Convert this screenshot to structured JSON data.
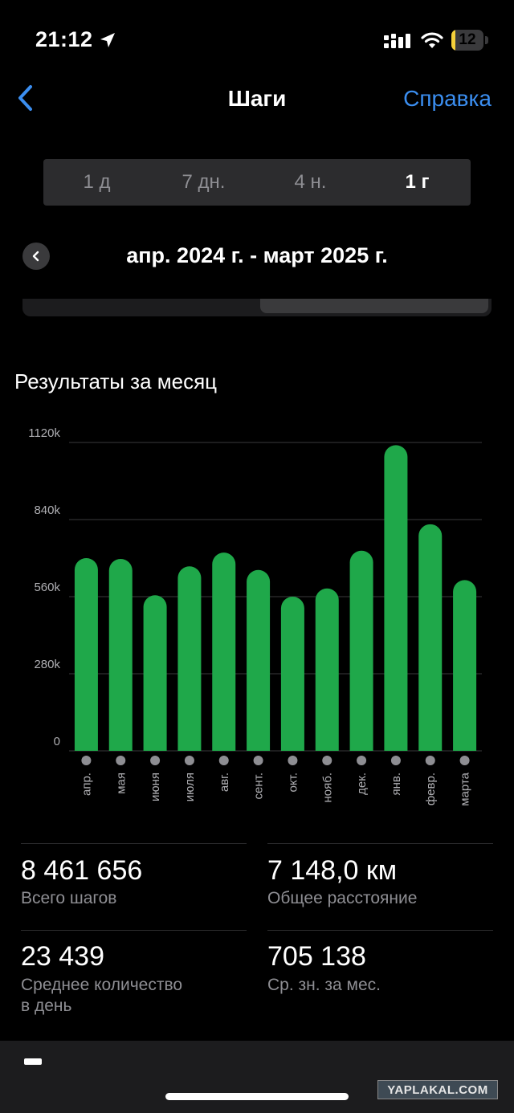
{
  "status_bar": {
    "time": "21:12",
    "battery": "12",
    "battery_level": 0.12
  },
  "nav": {
    "title": "Шаги",
    "help": "Справка"
  },
  "range_tabs": [
    {
      "label": "1 д",
      "active": false
    },
    {
      "label": "7 дн.",
      "active": false
    },
    {
      "label": "4 н.",
      "active": false
    },
    {
      "label": "1 г",
      "active": true
    }
  ],
  "date_range": "апр. 2024 г. - март 2025 г.",
  "section_title": "Результаты за месяц",
  "chart_data": {
    "type": "bar",
    "categories": [
      "апр.",
      "мая",
      "июня",
      "июля",
      "авг.",
      "сент.",
      "окт.",
      "нояб.",
      "дек.",
      "янв.",
      "февр.",
      "марта"
    ],
    "values": [
      700000,
      697000,
      565000,
      670000,
      720000,
      657000,
      560000,
      590000,
      727000,
      1110000,
      823000,
      620000
    ],
    "y_ticks": [
      "1120k",
      "840k",
      "560k",
      "280k",
      "0"
    ],
    "y_tick_values": [
      1120000,
      840000,
      560000,
      280000,
      0
    ],
    "ylim": [
      0,
      1120000
    ],
    "bar_color": "#1fa84a",
    "grid": true
  },
  "stats": [
    {
      "value": "8 461 656",
      "label": "Всего шагов"
    },
    {
      "value": "7 148,0 км",
      "label": "Общее расстояние"
    },
    {
      "value": "23 439",
      "label": "Среднее количество\nв день"
    },
    {
      "value": "705 138",
      "label": "Ср. зн. за мес."
    }
  ],
  "watermark": "YAPLAKAL.COM",
  "colors": {
    "accent": "#3b8ef0",
    "bar": "#1fa84a",
    "background": "#000000"
  }
}
